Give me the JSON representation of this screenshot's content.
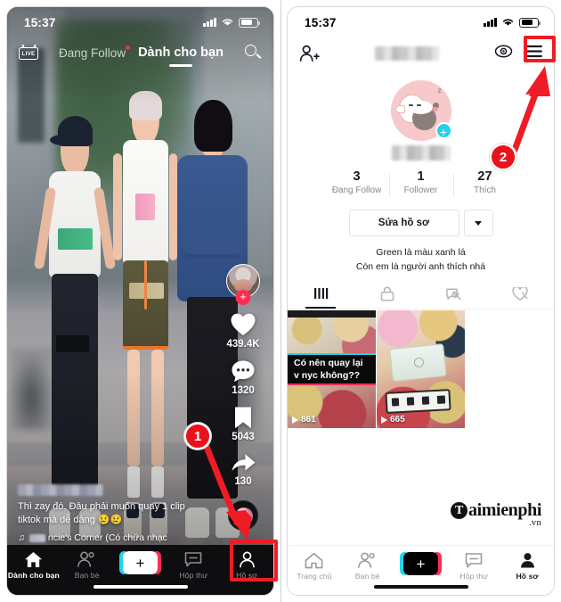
{
  "meta": {
    "accent_red": "#fe2c55",
    "accent_cyan": "#20d5ec",
    "annotation_red": "#e8121d"
  },
  "left_phone": {
    "status_bar": {
      "time": "15:37",
      "wifi_icon": "wifi-icon",
      "signal_icon": "signal-bars-icon",
      "battery_icon": "battery-icon"
    },
    "top_nav": {
      "live_label": "LIVE",
      "tabs": [
        {
          "label": "Đang Follow",
          "active": false,
          "has_dot": true
        },
        {
          "label": "Dành cho bạn",
          "active": true,
          "has_dot": false
        }
      ],
      "search_icon": "search-icon"
    },
    "action_rail": {
      "follow_plus": "+",
      "like_count": "439.4K",
      "comment_count": "1320",
      "bookmark_count": "5043",
      "share_count": "130",
      "music_disc": "music-disc-icon"
    },
    "caption": {
      "username": "",
      "text": "Thì zay đó. Đâu phải muốn quay 1 clip tiktok mà dễ dàng 😢😢",
      "music_note_icon": "music-note-icon",
      "music": "ncie's Corner (Có chứa nhạc"
    },
    "tabbar": [
      {
        "label": "Dành cho bạn",
        "icon": "home-icon",
        "active": true
      },
      {
        "label": "Bạn bè",
        "icon": "friends-icon",
        "active": false
      },
      {
        "label": "+",
        "icon": "create-icon",
        "active": false
      },
      {
        "label": "Hộp thư",
        "icon": "inbox-icon",
        "active": false
      },
      {
        "label": "Hồ sơ",
        "icon": "profile-icon",
        "active": false
      }
    ]
  },
  "right_phone": {
    "status_bar": {
      "time": "15:37",
      "wifi_icon": "wifi-icon",
      "signal_icon": "signal-bars-icon",
      "battery_icon": "battery-icon"
    },
    "header": {
      "add_friend_icon": "add-person-icon",
      "username": "",
      "eye_icon": "eye-icon",
      "menu_icon": "hamburger-menu-icon"
    },
    "avatar": {
      "plus_badge": "+",
      "sleep_text": "z"
    },
    "stats": [
      {
        "value": "3",
        "label": "Đang Follow"
      },
      {
        "value": "1",
        "label": "Follower"
      },
      {
        "value": "27",
        "label": "Thích"
      }
    ],
    "buttons": {
      "edit_profile": "Sửa hồ sơ",
      "dropdown_icon": "chevron-down-icon"
    },
    "bio": {
      "line1": "Green là màu xanh lá",
      "line2": "Còn em là người anh thích nhá"
    },
    "content_tabs": [
      {
        "icon": "grid-posts-icon",
        "active": true
      },
      {
        "icon": "lock-private-icon",
        "active": false
      },
      {
        "icon": "repost-icon",
        "active": false
      },
      {
        "icon": "heart-liked-icon",
        "active": false
      }
    ],
    "videos": [
      {
        "views": "861",
        "overlay_text": "Có nên quay lại v nyc không??",
        "play_icon": "play-icon"
      },
      {
        "views": "665",
        "overlay_text": "",
        "play_icon": "play-icon"
      }
    ],
    "watermark": {
      "initial": "T",
      "name": "aimienphi",
      "domain": ".vn"
    },
    "tabbar": [
      {
        "label": "Trang chủ",
        "icon": "home-icon",
        "active": false
      },
      {
        "label": "Bạn bè",
        "icon": "friends-icon",
        "active": false
      },
      {
        "label": "+",
        "icon": "create-icon",
        "active": false
      },
      {
        "label": "Hộp thư",
        "icon": "inbox-icon",
        "active": false
      },
      {
        "label": "Hồ sơ",
        "icon": "profile-icon",
        "active": true
      }
    ]
  },
  "annotations": [
    {
      "number": "1",
      "target": "left-phone-profile-tab"
    },
    {
      "number": "2",
      "target": "right-phone-hamburger-menu"
    }
  ]
}
